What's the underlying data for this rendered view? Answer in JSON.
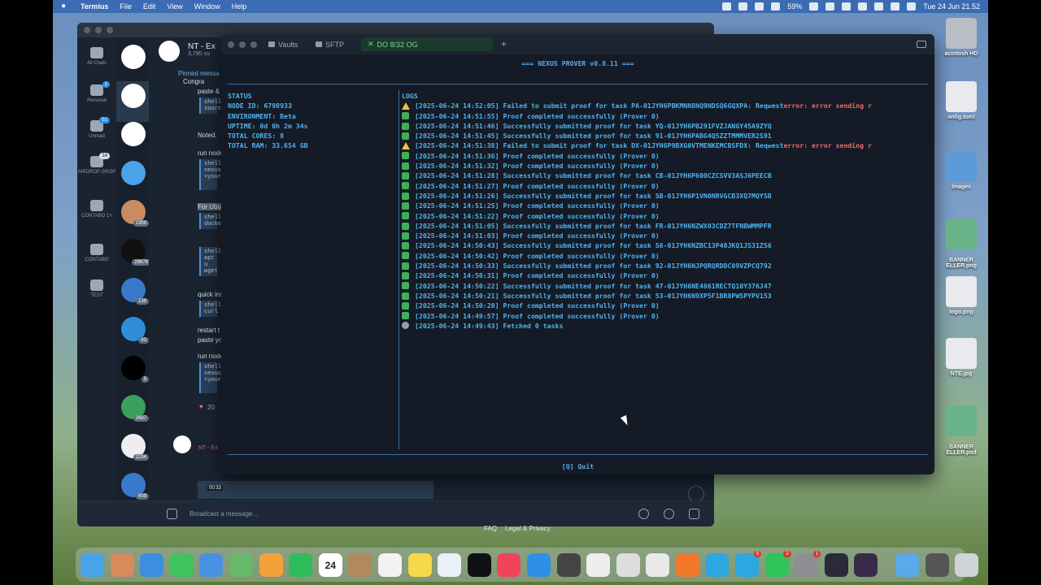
{
  "menubar": {
    "app": "Termius",
    "items": [
      "File",
      "Edit",
      "View",
      "Window",
      "Help"
    ],
    "battery": "59%",
    "datetime": "Tue 24 Jun  21.52"
  },
  "telegram": {
    "rail": [
      {
        "label": "All Chats",
        "badge": ""
      },
      {
        "label": "Personal",
        "badge": "1"
      },
      {
        "label": "Unread",
        "badge": "51"
      },
      {
        "label": "AIRDROP GROP",
        "badge": "14"
      },
      {
        "label": "CONTABO 1+",
        "badge": ""
      },
      {
        "label": "CONTABO",
        "badge": ""
      },
      {
        "label": "TEST",
        "badge": ""
      }
    ],
    "chat_counts": [
      "1309",
      "29678",
      "138",
      "43",
      "5",
      "2687",
      "2234",
      "609"
    ],
    "header_title": "NT - Ex",
    "header_sub": "3,790 su",
    "pinned": "Pinned messa",
    "msgs": {
      "congrat": "Congra",
      "paste": "paste &",
      "noted": "Noted.",
      "run1": "run node",
      "for_ubu": "For Ubu",
      "quick": "quick ins",
      "restart": "restart t",
      "paste_you": "paste yo",
      "run2": "run node",
      "reaction": "20",
      "reply_name": "NT - Ex",
      "video_time": "00:33"
    },
    "code": {
      "c1a": "shell",
      "c1b": "sourc",
      "c2a": "shell",
      "c2b": "nexus",
      "c2c": "<your",
      "c3a": "shell",
      "c3b": "docke",
      "c4a": "shell",
      "c4b": "apt u",
      "c4c": "wget",
      "c5a": "shell",
      "c5b": "curl",
      "c6a": "shell",
      "c6b": "nexus",
      "c6c": "<your"
    },
    "input_placeholder": "Broadcast a message...",
    "footer_links": [
      "FAQ",
      "Legal & Privacy"
    ]
  },
  "termius": {
    "tabs": [
      "Vaults",
      "SFTP",
      "DO 8/32 OG"
    ],
    "title": "=== NEXUS PROVER v0.8.11 ===",
    "status": {
      "heading": "STATUS",
      "node_id": "NODE ID: 6798933",
      "environment": "ENVIRONMENT: Beta",
      "uptime": "UPTIME: 0d 0h 2m 34s",
      "total_cores": "TOTAL CORES: 8",
      "total_ram": "TOTAL RAM: 33.654 GB"
    },
    "logs_heading": "LOGS",
    "logs": [
      {
        "kind": "warn",
        "text": "[2025-06-24 14:52:05] Failed to submit proof for task PA-01JYH6PBKMNN8NQ9NDSQ6GQXPA: Reqwest ",
        "err": "error: error sending r"
      },
      {
        "kind": "ok",
        "text": "[2025-06-24 14:51:55] Proof completed successfully (Prover 0)",
        "err": ""
      },
      {
        "kind": "ok",
        "text": "[2025-06-24 14:51:46] Successfully submitted proof for task YQ-01JYH6PB291FVZJANGY45A9ZYQ",
        "err": ""
      },
      {
        "kind": "ok",
        "text": "[2025-06-24 14:51:45] Successfully submitted proof for task 91-01JYH6PABG4Q5ZZTMMMVER2S91",
        "err": ""
      },
      {
        "kind": "warn",
        "text": "[2025-06-24 14:51:38] Failed to submit proof for task DX-01JYH6P9BXG0VTMENKEMCBSFDX: Reqwest ",
        "err": "error: error sending r"
      },
      {
        "kind": "ok",
        "text": "[2025-06-24 14:51:36] Proof completed successfully (Prover 0)",
        "err": ""
      },
      {
        "kind": "ok",
        "text": "[2025-06-24 14:51:32] Proof completed successfully (Prover 0)",
        "err": ""
      },
      {
        "kind": "ok",
        "text": "[2025-06-24 14:51:28] Successfully submitted proof for task CB-01JYH6P600CZCSVV3ASJ6PEECB",
        "err": ""
      },
      {
        "kind": "ok",
        "text": "[2025-06-24 14:51:27] Proof completed successfully (Prover 0)",
        "err": ""
      },
      {
        "kind": "ok",
        "text": "[2025-06-24 14:51:26] Successfully submitted proof for task SB-01JYH6P1VN0NRVGCB3XQ7MQYSB",
        "err": ""
      },
      {
        "kind": "ok",
        "text": "[2025-06-24 14:51:25] Proof completed successfully (Prover 0)",
        "err": ""
      },
      {
        "kind": "ok",
        "text": "[2025-06-24 14:51:22] Proof completed successfully (Prover 0)",
        "err": ""
      },
      {
        "kind": "ok",
        "text": "[2025-06-24 14:51:05] Successfully submitted proof for task FR-01JYH6NZWX03CDZ7TFNBWMMPFR",
        "err": ""
      },
      {
        "kind": "ok",
        "text": "[2025-06-24 14:51:03] Proof completed successfully (Prover 0)",
        "err": ""
      },
      {
        "kind": "ok",
        "text": "[2025-06-24 14:50:43] Successfully submitted proof for task S6-01JYH6NZBC13P40JKQ1JS31ZS6",
        "err": ""
      },
      {
        "kind": "ok",
        "text": "[2025-06-24 14:50:42] Proof completed successfully (Prover 0)",
        "err": ""
      },
      {
        "kind": "ok",
        "text": "[2025-06-24 14:50:33] Successfully submitted proof for task 92-01JYH6NJPQRQRDDC09VZPCQ792",
        "err": ""
      },
      {
        "kind": "ok",
        "text": "[2025-06-24 14:50:31] Proof completed successfully (Prover 0)",
        "err": ""
      },
      {
        "kind": "ok",
        "text": "[2025-06-24 14:50:22] Successfully submitted proof for task 47-01JYH6NE4861RECTQ10Y376J47",
        "err": ""
      },
      {
        "kind": "ok",
        "text": "[2025-06-24 14:50:21] Successfully submitted proof for task 53-01JYH6N9XP5F1BR8PWSPYPV153",
        "err": ""
      },
      {
        "kind": "ok",
        "text": "[2025-06-24 14:50:20] Proof completed successfully (Prover 0)",
        "err": ""
      },
      {
        "kind": "ok",
        "text": "[2025-06-24 14:49:57] Proof completed successfully (Prover 0)",
        "err": ""
      },
      {
        "kind": "fetch",
        "text": "[2025-06-24 14:49:43] Fetched 0 tasks",
        "err": ""
      }
    ],
    "quit": "[Q] Quit"
  },
  "desktop_icons": [
    "acintosh HD",
    "onfig.toml",
    "Images",
    "BANNER\nELLER.png",
    "logo.png",
    "NTE.jpg",
    "BANNER\nELLER.psd"
  ],
  "dock": {
    "calendar_month": "JUN",
    "calendar_day": "24",
    "badges": {
      "telegram": "5",
      "whatsapp": "2",
      "settings": "1"
    }
  },
  "colors": {
    "terminal_bg": "#141b26",
    "terminal_text": "#4fb3f0",
    "error_text": "#ef6a6a",
    "success_icon": "#3fb05a",
    "warn_icon": "#f2c23a"
  }
}
